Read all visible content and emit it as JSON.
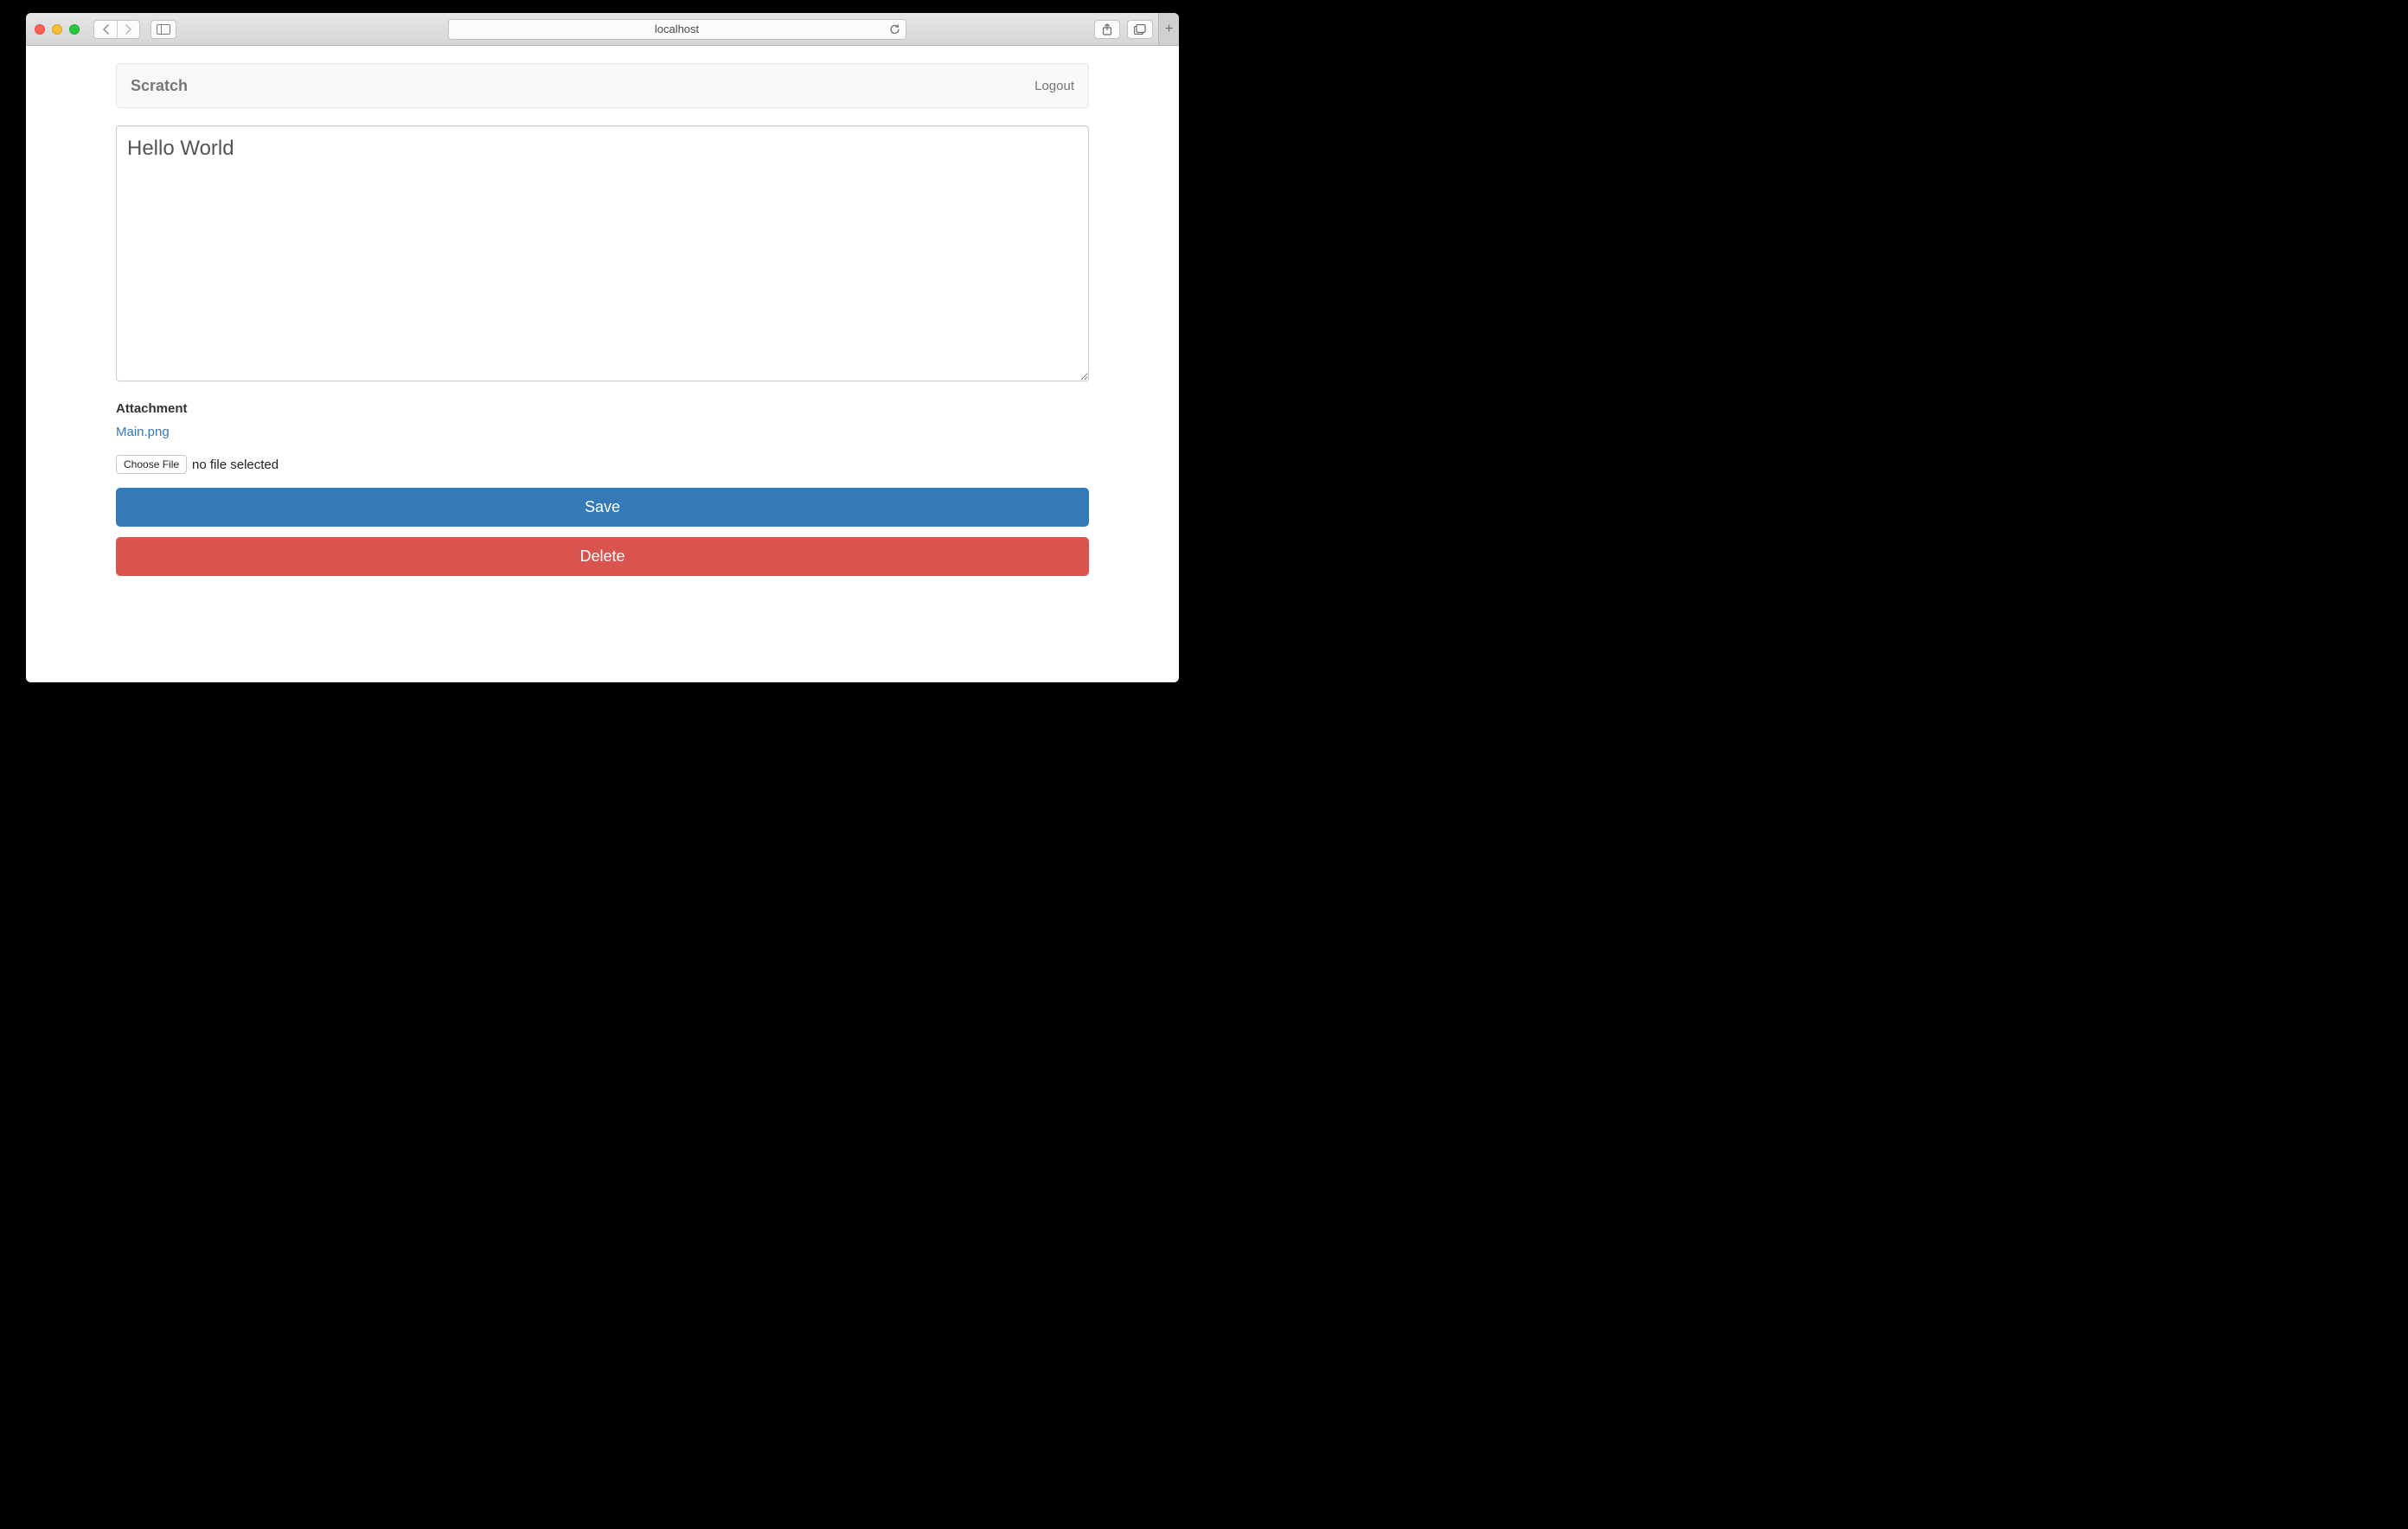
{
  "browser": {
    "address": "localhost"
  },
  "navbar": {
    "brand": "Scratch",
    "logout": "Logout"
  },
  "form": {
    "content_value": "Hello World",
    "attachment_label": "Attachment",
    "attachment_filename": "Main.png",
    "choose_file_label": "Choose File",
    "file_status": "no file selected",
    "save_label": "Save",
    "delete_label": "Delete"
  }
}
